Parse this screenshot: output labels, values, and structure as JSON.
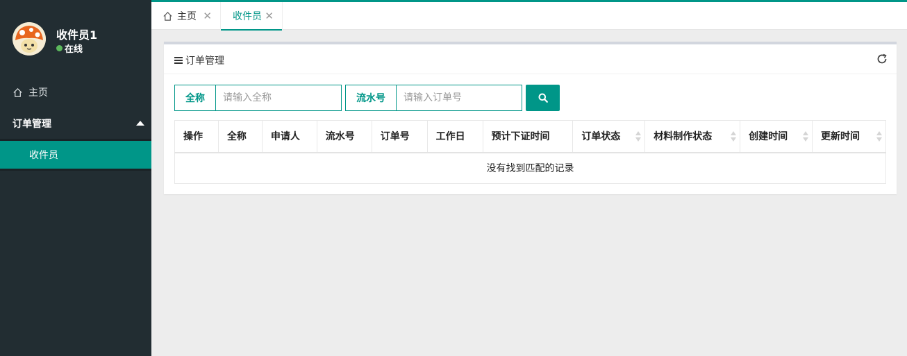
{
  "sidebar": {
    "user": {
      "name": "收件员1",
      "status": "在线",
      "status_color": "#5cb85c"
    },
    "menu": {
      "home": {
        "label": "主页",
        "icon": "home-icon"
      },
      "group": {
        "label": "订单管理",
        "icon": "caret-up-icon"
      },
      "active_item": {
        "label": "收件员"
      }
    }
  },
  "tabs": [
    {
      "label": "主页",
      "icon": "home-icon"
    },
    {
      "label": "收件员"
    }
  ],
  "panel": {
    "title": "订单管理",
    "search": {
      "field1": {
        "label": "全称",
        "placeholder": "请输入全称",
        "value": ""
      },
      "field2": {
        "label": "流水号",
        "placeholder": "请输入订单号",
        "value": ""
      },
      "button_icon": "search-icon"
    },
    "table": {
      "columns": [
        "操作",
        "全称",
        "申请人",
        "流水号",
        "订单号",
        "工作日",
        "预计下证时间",
        "订单状态",
        "材料制作状态",
        "创建时间",
        "更新时间"
      ],
      "empty_text": "没有找到匹配的记录"
    }
  },
  "colors": {
    "accent": "#009688",
    "sidebar_bg": "#222d32"
  }
}
